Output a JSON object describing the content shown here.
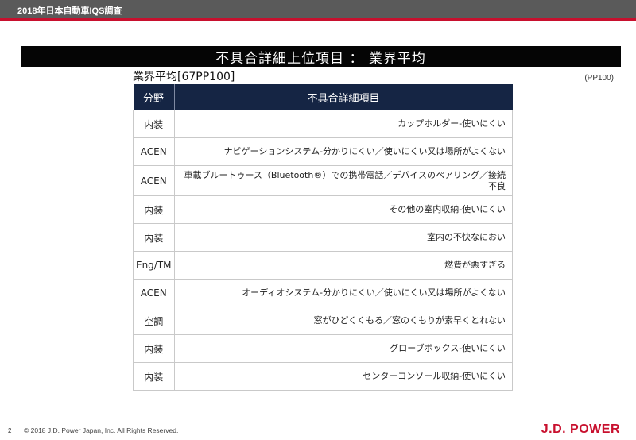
{
  "header": {
    "title": "2018年日本自動車IQS調査"
  },
  "banner": {
    "title": "不具合詳細上位項目 ： 業界平均"
  },
  "subhead": {
    "label": "業界平均[67PP100]"
  },
  "unit": {
    "label": "(PP100)"
  },
  "table": {
    "columns": [
      "分野",
      "不具合詳細項目"
    ],
    "rows": [
      {
        "category": "内装",
        "item": "カップホルダー-使いにくい"
      },
      {
        "category": "ACEN",
        "item": "ナビゲーションシステム-分かりにくい／使いにくい又は場所がよくない"
      },
      {
        "category": "ACEN",
        "item": "車載ブルートゥース（Bluetooth®）での携帯電話／デバイスのペアリング／接続不良"
      },
      {
        "category": "内装",
        "item": "その他の室内収納-使いにくい"
      },
      {
        "category": "内装",
        "item": "室内の不快なにおい"
      },
      {
        "category": "Eng/TM",
        "item": "燃費が悪すぎる"
      },
      {
        "category": "ACEN",
        "item": "オーディオシステム-分かりにくい／使いにくい又は場所がよくない"
      },
      {
        "category": "空調",
        "item": "窓がひどくくもる／窓のくもりが素早くとれない"
      },
      {
        "category": "内装",
        "item": "グローブボックス-使いにくい"
      },
      {
        "category": "内装",
        "item": "センターコンソール収納-使いにくい"
      }
    ]
  },
  "footer": {
    "page_number": "2",
    "copyright": "© 2018 J.D. Power Japan, Inc. All Rights Reserved.",
    "logo": "J.D. POWER"
  },
  "colors": {
    "header_bg": "#5a5a5a",
    "accent_red": "#c8102e",
    "table_header_bg": "#152544",
    "banner_bg": "#050505"
  }
}
